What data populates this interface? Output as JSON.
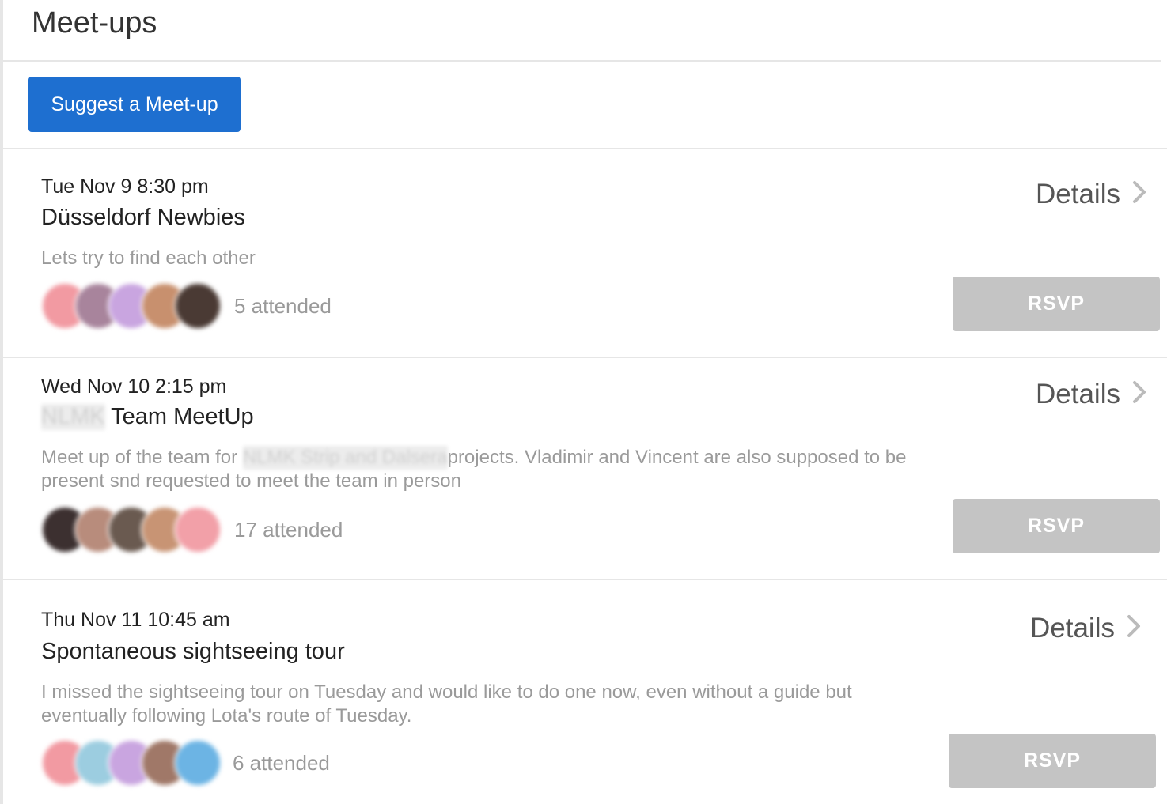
{
  "page": {
    "title": "Meet-ups"
  },
  "toolbar": {
    "suggest_label": "Suggest a Meet-up"
  },
  "meetups": [
    {
      "datetime": "Tue Nov 9 8:30 pm",
      "title": "Düsseldorf Newbies",
      "title_redacted": "",
      "description_parts": [
        "Lets try to find each other",
        "",
        ""
      ],
      "attended": "5 attended",
      "details_label": "Details",
      "rsvp_label": "RSVP",
      "avatar_colors": [
        "#f29aa2",
        "#a8849c",
        "#c9a5e0",
        "#c8906e",
        "#4a3a34"
      ]
    },
    {
      "datetime": "Wed Nov 10 2:15 pm",
      "title": "Team MeetUp",
      "title_redacted": "NLMK",
      "description_parts": [
        "Meet up of the team for ",
        "NLMK Strip and Dalsera",
        "projects. Vladimir and Vincent are also supposed to be present snd requested to meet the team in person"
      ],
      "attended": "17 attended",
      "details_label": "Details",
      "rsvp_label": "RSVP",
      "avatar_colors": [
        "#3c3030",
        "#b88c7c",
        "#6a5a50",
        "#c89474",
        "#f2a0a8"
      ]
    },
    {
      "datetime": "Thu Nov 11 10:45 am",
      "title": "Spontaneous sightseeing tour",
      "title_redacted": "",
      "description_parts": [
        "I missed the sightseeing tour on Tuesday and would like to do one now, even without a guide but eventually following Lota's route of Tuesday.",
        "",
        ""
      ],
      "attended": "6 attended",
      "details_label": "Details",
      "rsvp_label": "RSVP",
      "avatar_colors": [
        "#f29aa2",
        "#9ccde0",
        "#c9a5e0",
        "#a07868",
        "#6cb4e4"
      ]
    }
  ],
  "colors": {
    "accent": "#1e6fd0",
    "rsvp_disabled": "#c4c4c4",
    "muted_text": "#9a9a9a"
  },
  "icons": {
    "details": "chevron-right-icon",
    "avatar": "user-avatar"
  }
}
